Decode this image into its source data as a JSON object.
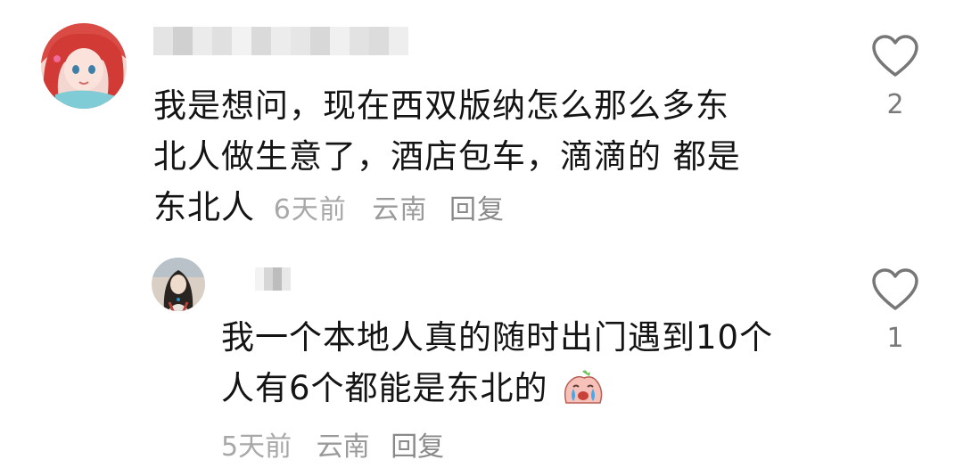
{
  "comments": [
    {
      "text_lines": [
        "我是想问，现在西双版纳怎么那么多东",
        "北人做生意了，酒店包车，滴滴的 都是"
      ],
      "last_line": "东北人",
      "date": "6天前",
      "location": "云南",
      "reply_label": "回复",
      "like_count": "2",
      "avatar_icon": "mermaid-avatar-icon"
    },
    {
      "text_lines": [
        "我一个本地人真的随时出门遇到10个",
        "人有6个都能是东北的"
      ],
      "date": "5天前",
      "location": "云南",
      "reply_label": "回复",
      "like_count": "1",
      "avatar_icon": "girl-portrait-avatar-icon",
      "emoji_icon": "crying-peach-emoji-icon"
    }
  ],
  "colors": {
    "text": "#141414",
    "meta": "#9a9a9a",
    "heart": "#7a7a7a"
  }
}
